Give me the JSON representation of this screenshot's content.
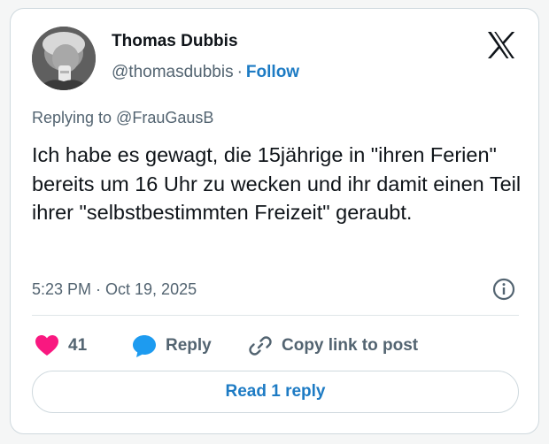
{
  "author": {
    "name": "Thomas Dubbis",
    "handle": "@thomasdubbis",
    "separator": "·",
    "follow_label": "Follow"
  },
  "tweet": {
    "replying_to": "Replying to @FrauGausB",
    "text": "Ich habe es gewagt, die 15jährige in \"ihren Ferien\" bereits um 16 Uhr zu wecken und ihr damit einen Teil ihrer \"selbstbestimmten Freizeit\" geraubt.",
    "timestamp": "5:23 PM · Oct 19, 2025"
  },
  "actions": {
    "like_count": "41",
    "reply_label": "Reply",
    "copy_link_label": "Copy link to post",
    "read_reply_label": "Read 1 reply"
  },
  "icons": {
    "brand": "x-logo-icon",
    "info": "info-icon",
    "like": "heart-icon",
    "reply": "speech-bubble-icon",
    "copy": "link-icon"
  },
  "colors": {
    "like": "#f91880",
    "reply": "#1d9bf0",
    "link": "#1d7bc4",
    "muted": "#536471"
  }
}
